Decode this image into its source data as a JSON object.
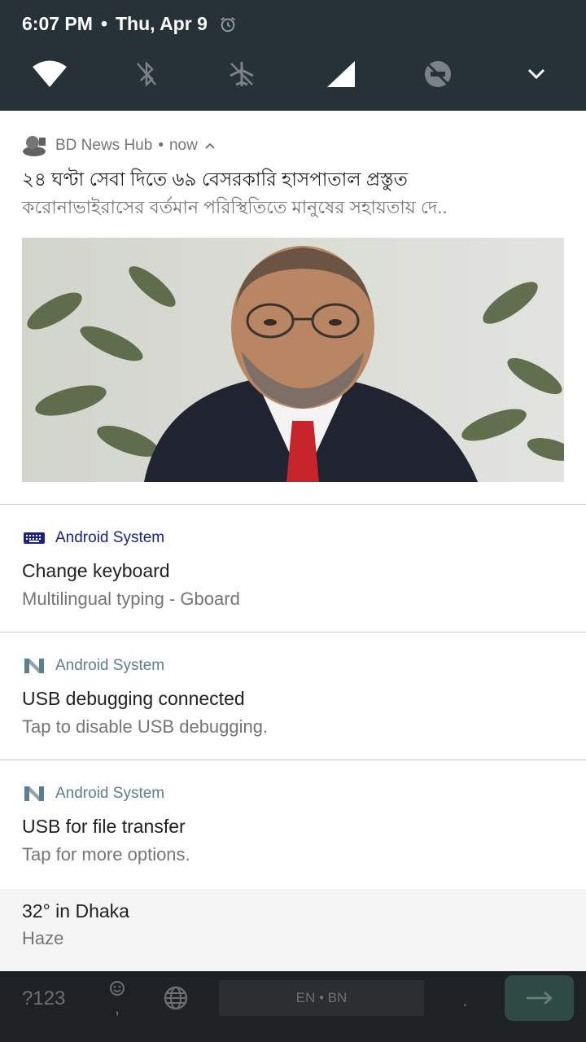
{
  "status_bar": {
    "time": "6:07 PM",
    "separator": "•",
    "date": "Thu, Apr 9"
  },
  "quick_settings": [
    "wifi-icon",
    "bluetooth-off-icon",
    "airplane-off-icon",
    "signal-icon",
    "do-not-disturb-off-icon",
    "expand-icon"
  ],
  "notifications": [
    {
      "app": "BD News Hub",
      "time": "now",
      "meta_sep": "•",
      "title": "২৪ ঘণ্টা সেবা দিতে ৬৯ বেসরকারি হাসপাতাল প্রস্তুত",
      "text": "করোনাভাইরাসের বর্তমান পরিস্থিতিতে মানুষের সহায়তায় দে..",
      "image": "news-photo"
    },
    {
      "app": "Android System",
      "title": "Change keyboard",
      "text": "Multilingual typing - Gboard",
      "icon": "keyboard-icon",
      "accent": "#1a237e"
    },
    {
      "app": "Android System",
      "title": "USB debugging connected",
      "text": "Tap to disable USB debugging.",
      "icon": "android-n-icon",
      "accent": "#607d8b"
    },
    {
      "app": "Android System",
      "title": "USB for file transfer",
      "text": "Tap for more options.",
      "icon": "android-n-icon",
      "accent": "#607d8b"
    }
  ],
  "weather": {
    "title": "32° in Dhaka",
    "text": "Haze"
  },
  "keyboard": {
    "symbols": "?123",
    "comma": ",",
    "space_label": "EN • BN",
    "period": "."
  },
  "colors": {
    "shade": "#263238",
    "primary_text": "#212121",
    "secondary_text": "#757575",
    "enter_key": "#2e4a44"
  }
}
